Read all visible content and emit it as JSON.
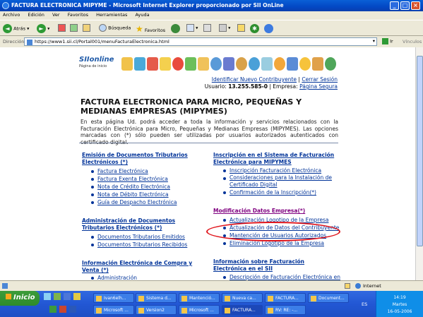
{
  "window": {
    "title": "FACTURA ELECTRONICA MIPYME - Microsoft Internet Explorer proporcionado por SII OnLine"
  },
  "menu": [
    "Archivo",
    "Edición",
    "Ver",
    "Favoritos",
    "Herramientas",
    "Ayuda"
  ],
  "toolbar": {
    "back": "Atrás",
    "search": "Búsqueda",
    "favorites": "Favoritos"
  },
  "address": {
    "label": "Dirección",
    "url": "https://www1.sii.cl/Portal001/menuFacturaElectronica.html",
    "go": "Ir",
    "links": "Vínculos"
  },
  "header": {
    "logo_text": "SIIonline",
    "logo_sub": "Página de inicio",
    "identify_new": "Identificar Nuevo Contribuyente",
    "separator": "|",
    "logout": "Cerrar Sesión",
    "user_label": "Usuario:",
    "user_value": "13.255.585-0",
    "company_label": "| Empresa:",
    "secure_page": "Página Segura"
  },
  "page": {
    "title": "FACTURA ELECTRONICA PARA MICRO, PEQUEÑAS Y MEDIANAS EMPRESAS (MIPYMES)",
    "intro": "En esta página Ud. podrá acceder a toda la información y servicios relacionados con la Facturación Electrónica para Micro, Pequeñas y Medianas Empresas (MIPYMES). Las opciones marcadas con (*) sólo pueden ser utilizadas por usuarios autorizados autenticados con certificado digital."
  },
  "sections": {
    "emision": {
      "title": "Emisión de Documentos Tributarios Electrónicos (*)",
      "items": [
        "Factura Electrónica",
        "Factura Exenta Electrónica",
        "Nota de Crédito Electrónica",
        "Nota de Débito Electrónica",
        "Guía de Despacho Electrónica"
      ]
    },
    "inscripcion": {
      "title": "Inscripción en el Sistema de Facturación Electrónica para MIPYMES",
      "items": [
        "Inscripción Facturación Electrónica",
        "Consideraciones para la Instalación de Certificado Digital",
        "Confirmación de la Inscripción(*)"
      ]
    },
    "administracion": {
      "title": "Administración de Documentos Tributarios Electrónicos (*)",
      "items": [
        "Documentos Tributarios Emitidos",
        "Documentos Tributarios Recibidos"
      ]
    },
    "modificacion": {
      "title": "Modificación Datos Empresa(*)",
      "items": [
        "Actualización Logotipo de la Empresa",
        "Actualización de Datos del Contribuyente",
        "Mantención de Usuarios Autorizados",
        "Eliminación Logotipo de la Empresa"
      ]
    },
    "compraventa": {
      "title": "Información Electrónica de Compra y Venta (*)",
      "items": [
        "Administración"
      ]
    },
    "informacion": {
      "title": "Información sobre Facturación Electrónica en el SII",
      "items": [
        "Descripción de Facturación Electrónica en"
      ]
    }
  },
  "status": {
    "zone": "Internet"
  },
  "taskbar": {
    "start": "Inicio",
    "row1": [
      "Ivan6elh...",
      "Sistema d...",
      "Mantenció...",
      "Nueva ca...",
      "FACTURA...",
      "Document..."
    ],
    "row2": [
      "Microsoft ...",
      "Version2",
      "Microsoft ...",
      "FACTURA...",
      "RV: RE: -..."
    ],
    "lang": "ES",
    "time": "14:19",
    "day": "Martes",
    "date": "16-05-2006"
  },
  "colors": {
    "highlight_ellipse": "#e0141b",
    "link": "#003399",
    "visited": "#800080",
    "title_bar": "#0348c4"
  }
}
